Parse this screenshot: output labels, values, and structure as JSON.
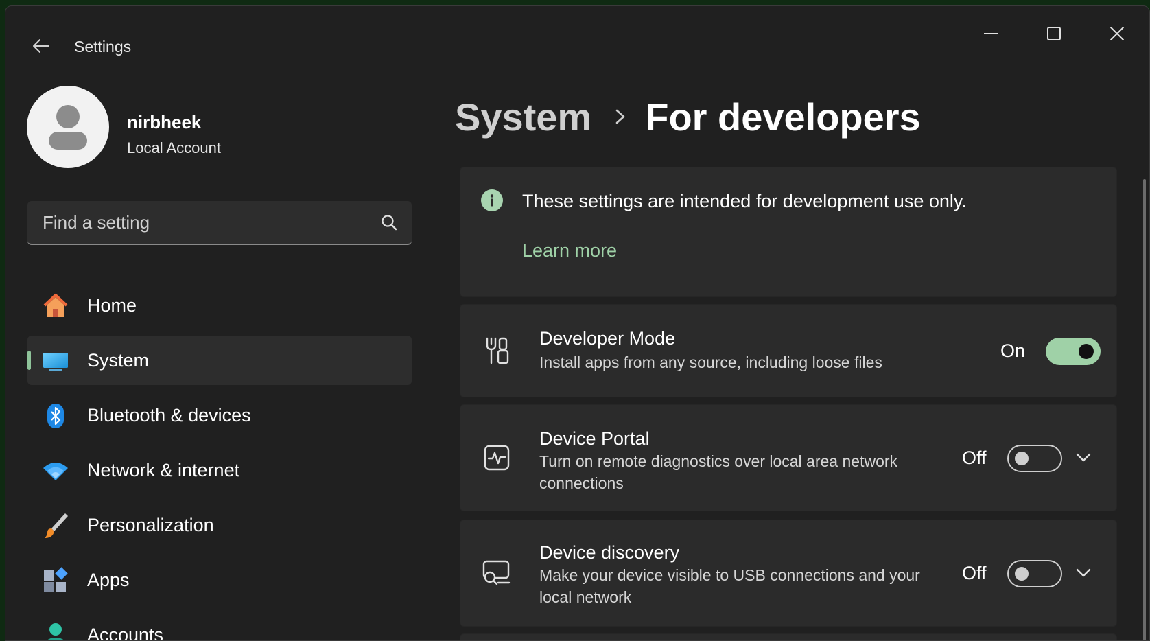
{
  "window": {
    "title": "Settings",
    "controls": [
      "minimize",
      "maximize",
      "close"
    ]
  },
  "profile": {
    "name": "nirbheek",
    "account_type": "Local Account"
  },
  "search": {
    "placeholder": "Find a setting",
    "value": ""
  },
  "nav": {
    "items": [
      {
        "label": "Home",
        "icon": "home-icon",
        "selected": false
      },
      {
        "label": "System",
        "icon": "system-icon",
        "selected": true
      },
      {
        "label": "Bluetooth & devices",
        "icon": "bluetooth-icon",
        "selected": false
      },
      {
        "label": "Network & internet",
        "icon": "wifi-icon",
        "selected": false
      },
      {
        "label": "Personalization",
        "icon": "brush-icon",
        "selected": false
      },
      {
        "label": "Apps",
        "icon": "apps-icon",
        "selected": false
      },
      {
        "label": "Accounts",
        "icon": "accounts-icon",
        "selected": false
      }
    ]
  },
  "header": {
    "parent": "System",
    "current": "For developers"
  },
  "info": {
    "text": "These settings are intended for development use only.",
    "link": "Learn more"
  },
  "settings": [
    {
      "title": "Developer Mode",
      "description": "Install apps from any source, including loose files",
      "state": "On",
      "enabled": true,
      "icon": "developer-tools-icon",
      "expandable": false
    },
    {
      "title": "Device Portal",
      "description": "Turn on remote diagnostics over local area network connections",
      "state": "Off",
      "enabled": false,
      "icon": "device-portal-icon",
      "expandable": true
    },
    {
      "title": "Device discovery",
      "description": "Make your device visible to USB connections and your local network",
      "state": "Off",
      "enabled": false,
      "icon": "device-discovery-icon",
      "expandable": true
    }
  ],
  "colors": {
    "accent": "#9fd1a7",
    "background": "#202020",
    "card": "#2b2b2b"
  }
}
